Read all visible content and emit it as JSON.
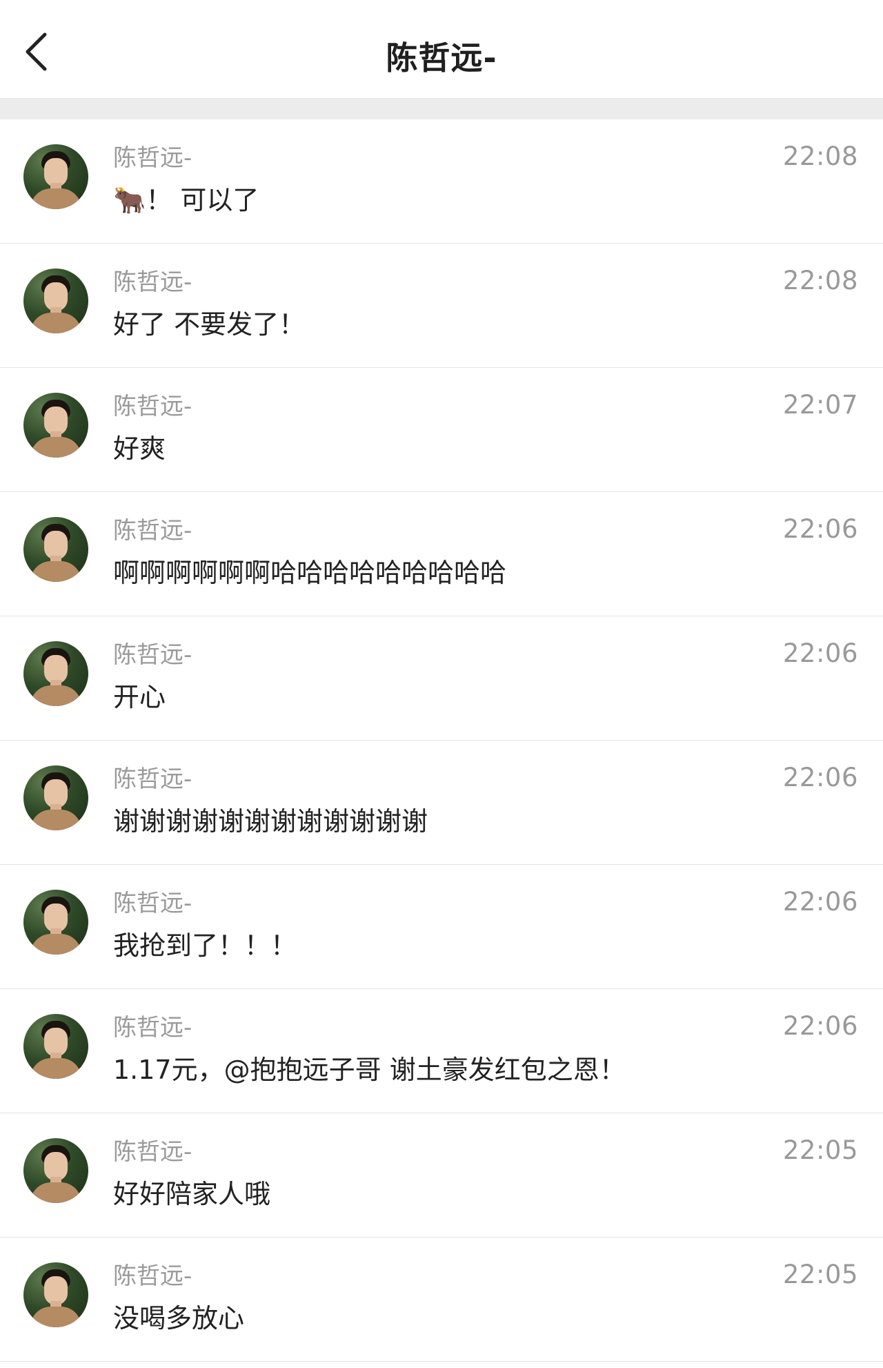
{
  "header": {
    "back_icon": "chevron-left-icon",
    "title": "陈哲远-"
  },
  "messages": [
    {
      "sender": "陈哲远-",
      "time": "22:08",
      "text": "🐂！ 可以了"
    },
    {
      "sender": "陈哲远-",
      "time": "22:08",
      "text": "好了 不要发了！"
    },
    {
      "sender": "陈哲远-",
      "time": "22:07",
      "text": "好爽"
    },
    {
      "sender": "陈哲远-",
      "time": "22:06",
      "text": "啊啊啊啊啊啊哈哈哈哈哈哈哈哈哈"
    },
    {
      "sender": "陈哲远-",
      "time": "22:06",
      "text": "开心"
    },
    {
      "sender": "陈哲远-",
      "time": "22:06",
      "text": "谢谢谢谢谢谢谢谢谢谢谢谢"
    },
    {
      "sender": "陈哲远-",
      "time": "22:06",
      "text": "我抢到了！！！"
    },
    {
      "sender": "陈哲远-",
      "time": "22:06",
      "text": "1.17元，@抱抱远子哥 谢土豪发红包之恩！"
    },
    {
      "sender": "陈哲远-",
      "time": "22:05",
      "text": "好好陪家人哦"
    },
    {
      "sender": "陈哲远-",
      "time": "22:05",
      "text": "没喝多放心"
    }
  ]
}
